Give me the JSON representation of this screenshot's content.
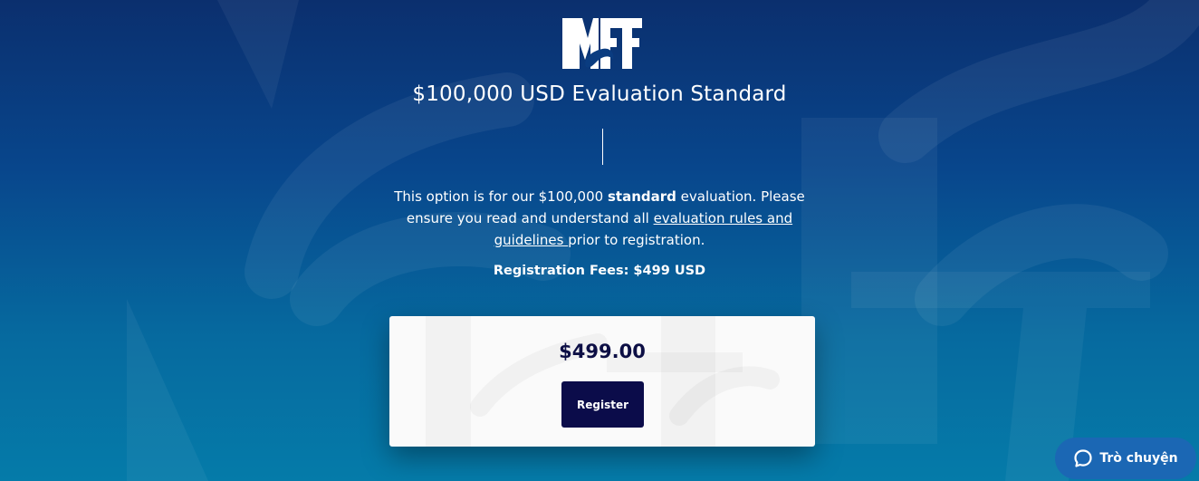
{
  "colors": {
    "background_top": "#0b2f6e",
    "background_bottom": "#057ba9",
    "card_background": "#fafafa",
    "button_navy": "#0b0c4a",
    "price_text": "#0d0f45",
    "chat_button": "#1b67b4"
  },
  "header": {
    "logo_text": "MFF",
    "title": "$100,000 USD Evaluation Standard"
  },
  "description": {
    "part1": "This option is for our $100,000 ",
    "bold": "standard",
    "part2": " evaluation. Please ensure you read and understand all ",
    "link_text": "evaluation rules and guidelines ",
    "part3": "prior to registration."
  },
  "fees": {
    "text": "Registration Fees: $499 USD"
  },
  "price_card": {
    "price": "$499.00",
    "register_label": "Register"
  },
  "chat": {
    "icon": "chat-bubble-icon",
    "label": "Trò chuyện"
  }
}
